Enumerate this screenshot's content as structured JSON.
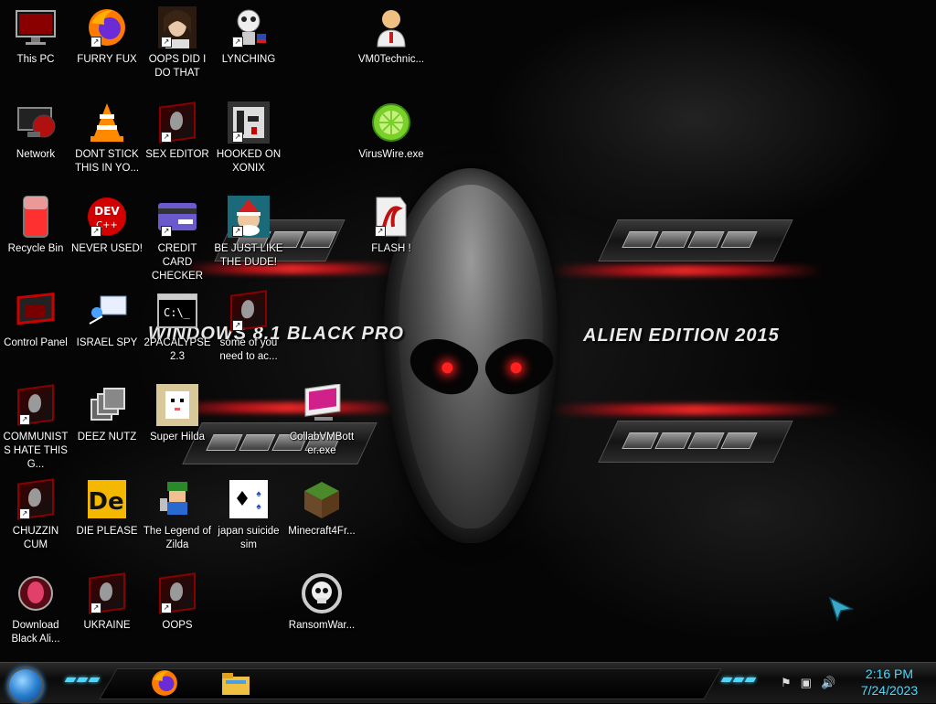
{
  "wallpaper": {
    "left_text": "WINDOWS 8.1 BLACK PRO",
    "right_text": "ALIEN EDITION 2015",
    "accent_color": "#ff2020"
  },
  "desktop": {
    "icons": [
      {
        "label": "This PC",
        "icon": "monitor-icon"
      },
      {
        "label": "FURRY FUX",
        "icon": "firefox-icon"
      },
      {
        "label": "OOPS DID I DO THAT",
        "icon": "portrait-icon"
      },
      {
        "label": "LYNCHING",
        "icon": "skull-figure-icon"
      },
      {
        "label": "VM0Technic...",
        "icon": "technician-icon"
      },
      {
        "label": "Network",
        "icon": "network-icon"
      },
      {
        "label": "DONT STICK THIS IN YO...",
        "icon": "vlc-cone-icon"
      },
      {
        "label": "SEX EDITOR",
        "icon": "alien-app-icon"
      },
      {
        "label": "HOOKED ON XONIX",
        "icon": "xonix-game-icon"
      },
      {
        "label": "VirusWire.exe",
        "icon": "lime-disc-icon"
      },
      {
        "label": "Recycle Bin",
        "icon": "recycle-bin-icon"
      },
      {
        "label": "NEVER USED!",
        "icon": "dev-cpp-icon"
      },
      {
        "label": "CREDIT CARD CHECKER",
        "icon": "credit-card-icon"
      },
      {
        "label": "BE JUST LIKE THE DUDE!",
        "icon": "santa-icon"
      },
      {
        "label": "FLASH !",
        "icon": "flash-document-icon"
      },
      {
        "label": "Control Panel",
        "icon": "control-panel-icon"
      },
      {
        "label": "ISRAEL SPY",
        "icon": "remote-desktop-icon"
      },
      {
        "label": "2PACALYPSE 2.3",
        "icon": "console-icon"
      },
      {
        "label": "some of you need to ac...",
        "icon": "alien-app-icon"
      },
      {
        "label": "COMMUNISTS HATE THIS G...",
        "icon": "alien-app-icon"
      },
      {
        "label": "DEEZ NUTZ",
        "icon": "windows-stack-icon"
      },
      {
        "label": "Super Hilda",
        "icon": "pixel-cat-icon"
      },
      {
        "label": "CollabVMBott er.exe",
        "icon": "collab-vm-icon"
      },
      {
        "label": "CHUZZIN CUM",
        "icon": "alien-app-icon"
      },
      {
        "label": "DIE PLEASE",
        "icon": "de-icon"
      },
      {
        "label": "The Legend of Zilda",
        "icon": "pixel-hero-icon"
      },
      {
        "label": "japan suicide sim",
        "icon": "playing-card-icon"
      },
      {
        "label": "Minecraft4Fr...",
        "icon": "grass-block-icon"
      },
      {
        "label": "Download Black Ali...",
        "icon": "alien-head-download-icon"
      },
      {
        "label": "UKRAINE",
        "icon": "alien-app-icon"
      },
      {
        "label": "OOPS",
        "icon": "alien-app-icon"
      },
      {
        "label": "RansomWar...",
        "icon": "skull-icon"
      }
    ]
  },
  "taskbar": {
    "start_icon": "start-orb-icon",
    "pinned": [
      "firefox-icon",
      "file-explorer-icon"
    ],
    "tray_icons": [
      "flag-icon",
      "network-tray-icon",
      "volume-icon"
    ],
    "time": "2:16 PM",
    "date": "7/24/2023"
  }
}
